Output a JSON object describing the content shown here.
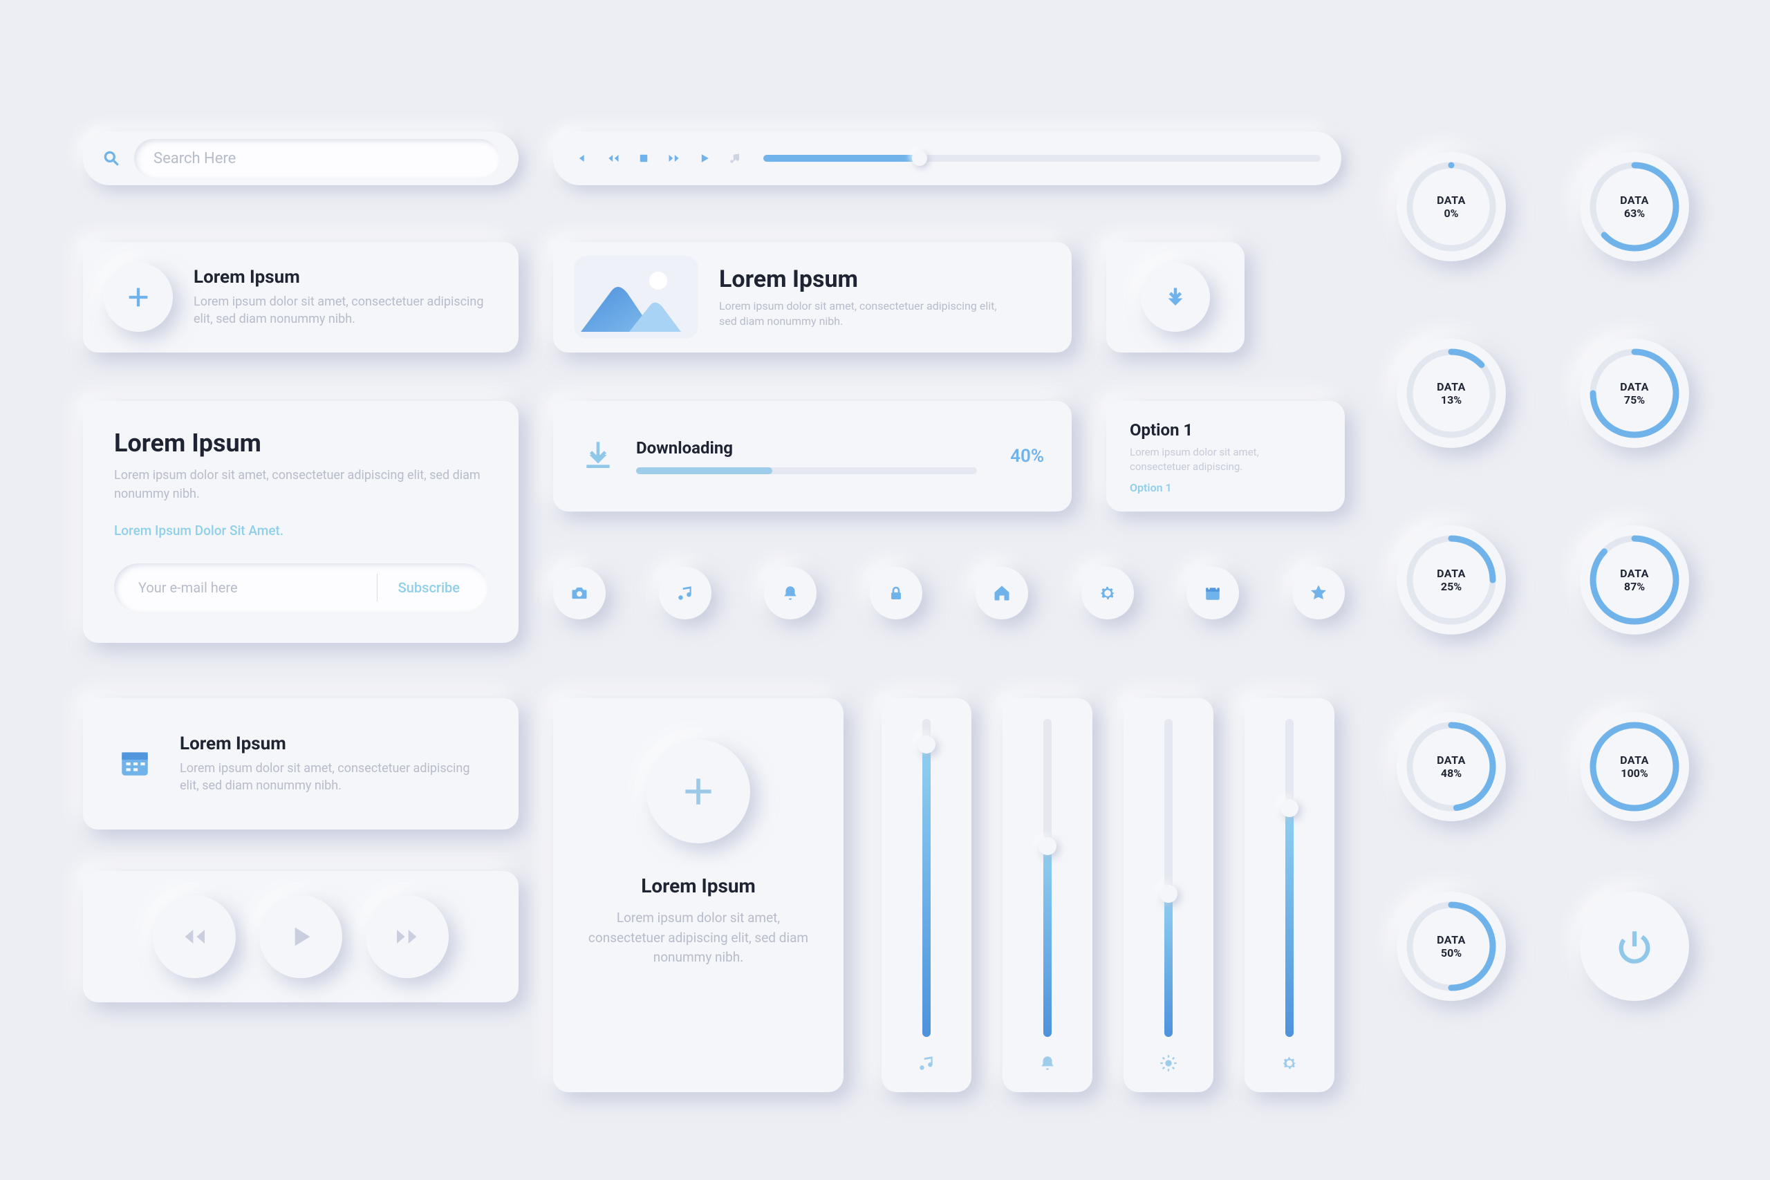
{
  "search": {
    "placeholder": "Search Here"
  },
  "player": {
    "progress_pct": 28
  },
  "gauges": [
    {
      "label": "DATA",
      "pct": 0
    },
    {
      "label": "DATA",
      "pct": 63
    },
    {
      "label": "DATA",
      "pct": 13
    },
    {
      "label": "DATA",
      "pct": 75
    },
    {
      "label": "DATA",
      "pct": 25
    },
    {
      "label": "DATA",
      "pct": 87
    },
    {
      "label": "DATA",
      "pct": 48
    },
    {
      "label": "DATA",
      "pct": 100
    },
    {
      "label": "DATA",
      "pct": 50
    }
  ],
  "card_add": {
    "title": "Lorem Ipsum",
    "body": "Lorem ipsum dolor sit amet, consectetuer adipiscing elit, sed diam nonummy nibh."
  },
  "card_img": {
    "title": "Lorem Ipsum",
    "body": "Lorem ipsum dolor sit amet, consectetuer adipiscing elit, sed diam nonummy nibh."
  },
  "card_sub": {
    "title": "Lorem Ipsum",
    "body": "Lorem ipsum dolor sit amet, consectetuer adipiscing elit, sed diam nonummy nibh.",
    "link": "Lorem Ipsum Dolor Sit Amet.",
    "placeholder": "Your e-mail here",
    "action": "Subscribe"
  },
  "download": {
    "title": "Downloading",
    "pct": 40,
    "pct_label": "40%"
  },
  "option": {
    "title": "Option 1",
    "body": "Lorem ipsum dolor sit amet, consectetuer adipiscing.",
    "link": "Option 1"
  },
  "card_cal": {
    "title": "Lorem Ipsum",
    "body": "Lorem ipsum dolor sit amet, consectetuer adipiscing elit, sed diam nonummy nibh."
  },
  "card_add2": {
    "title": "Lorem Ipsum",
    "body": "Lorem ipsum dolor sit amet, consectetuer adipiscing elit, sed diam nonummy nibh."
  },
  "vsliders": [
    {
      "icon": "music",
      "pct": 92
    },
    {
      "icon": "bell",
      "pct": 60
    },
    {
      "icon": "sun",
      "pct": 45
    },
    {
      "icon": "gear",
      "pct": 72
    }
  ]
}
